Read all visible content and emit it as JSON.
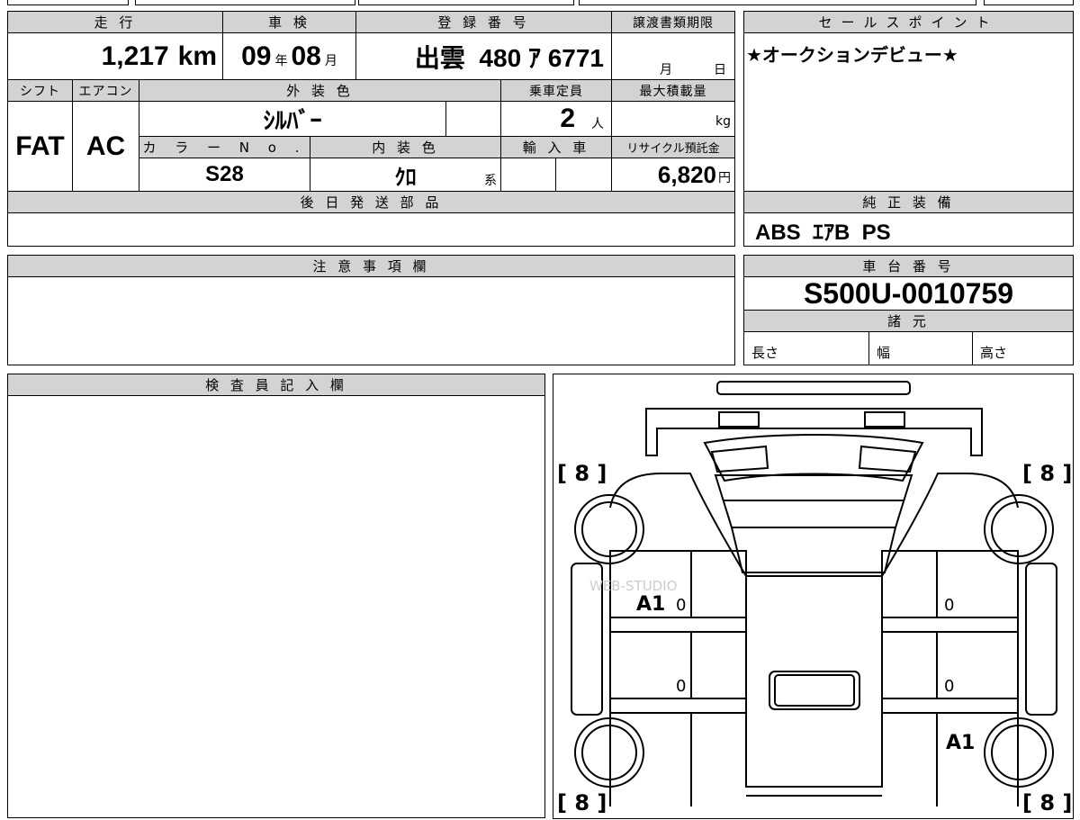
{
  "headers": {
    "mileage": "走 行",
    "inspection": "車 検",
    "registration": "登 録 番 号",
    "transfer_docs": "譲渡書類期限",
    "sales_point": "セールスポイント",
    "shift": "シフト",
    "aircon": "エアコン",
    "exterior_color": "外 装 色",
    "capacity": "乗車定員",
    "max_load": "最大積載量",
    "color_no": "カ ラ ー N o .",
    "interior_color": "内 装 色",
    "import": "輸 入 車",
    "recycle_fee": "リサイクル預託金",
    "later_parts": "後 日 発 送 部 品",
    "genuine_equipment": "純 正 装 備",
    "notes": "注 意 事 項 欄",
    "chassis_no": "車 台 番 号",
    "specs": "諸 元",
    "inspector": "検 査 員 記 入 欄"
  },
  "values": {
    "mileage": "1,217",
    "mileage_unit": "km",
    "inspection_year": "09",
    "year_unit": "年",
    "inspection_month": "08",
    "month_unit": "月",
    "registration": "出雲  480 ｱ 6771",
    "transfer_month": "月",
    "transfer_day": "日",
    "sales_point": "★オークションデビュー★",
    "shift": "FAT",
    "aircon": "AC",
    "exterior_color": "ｼﾙﾊﾞｰ",
    "capacity": "2",
    "capacity_unit": "人",
    "max_load_unit": "kg",
    "color_no": "S28",
    "interior_color": "ｸﾛ",
    "interior_suffix": "系",
    "recycle_fee": "6,820",
    "yen_unit": "円",
    "genuine_equipment": "ABS  ｴｱB  PS",
    "chassis_no": "S500U-0010759",
    "length_label": "長さ",
    "width_label": "幅",
    "height_label": "高さ"
  },
  "diagram": {
    "corner_marks": [
      "[ 8 ]",
      "[ 8 ]",
      "[ 8 ]",
      "[ 8 ]"
    ],
    "annotations": [
      "A1",
      "A1"
    ],
    "zeros": [
      "0",
      "0",
      "0",
      "0"
    ],
    "watermark": "WEB-STUDIO"
  }
}
